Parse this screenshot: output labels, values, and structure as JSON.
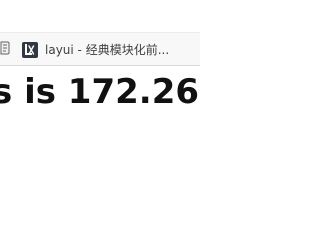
{
  "bookmarks_bar": {
    "items": [
      {
        "label": "layui - 经典模块化前...",
        "icon": "layui-logo-icon"
      }
    ]
  },
  "page": {
    "visible_text": "s is 172.26"
  }
}
